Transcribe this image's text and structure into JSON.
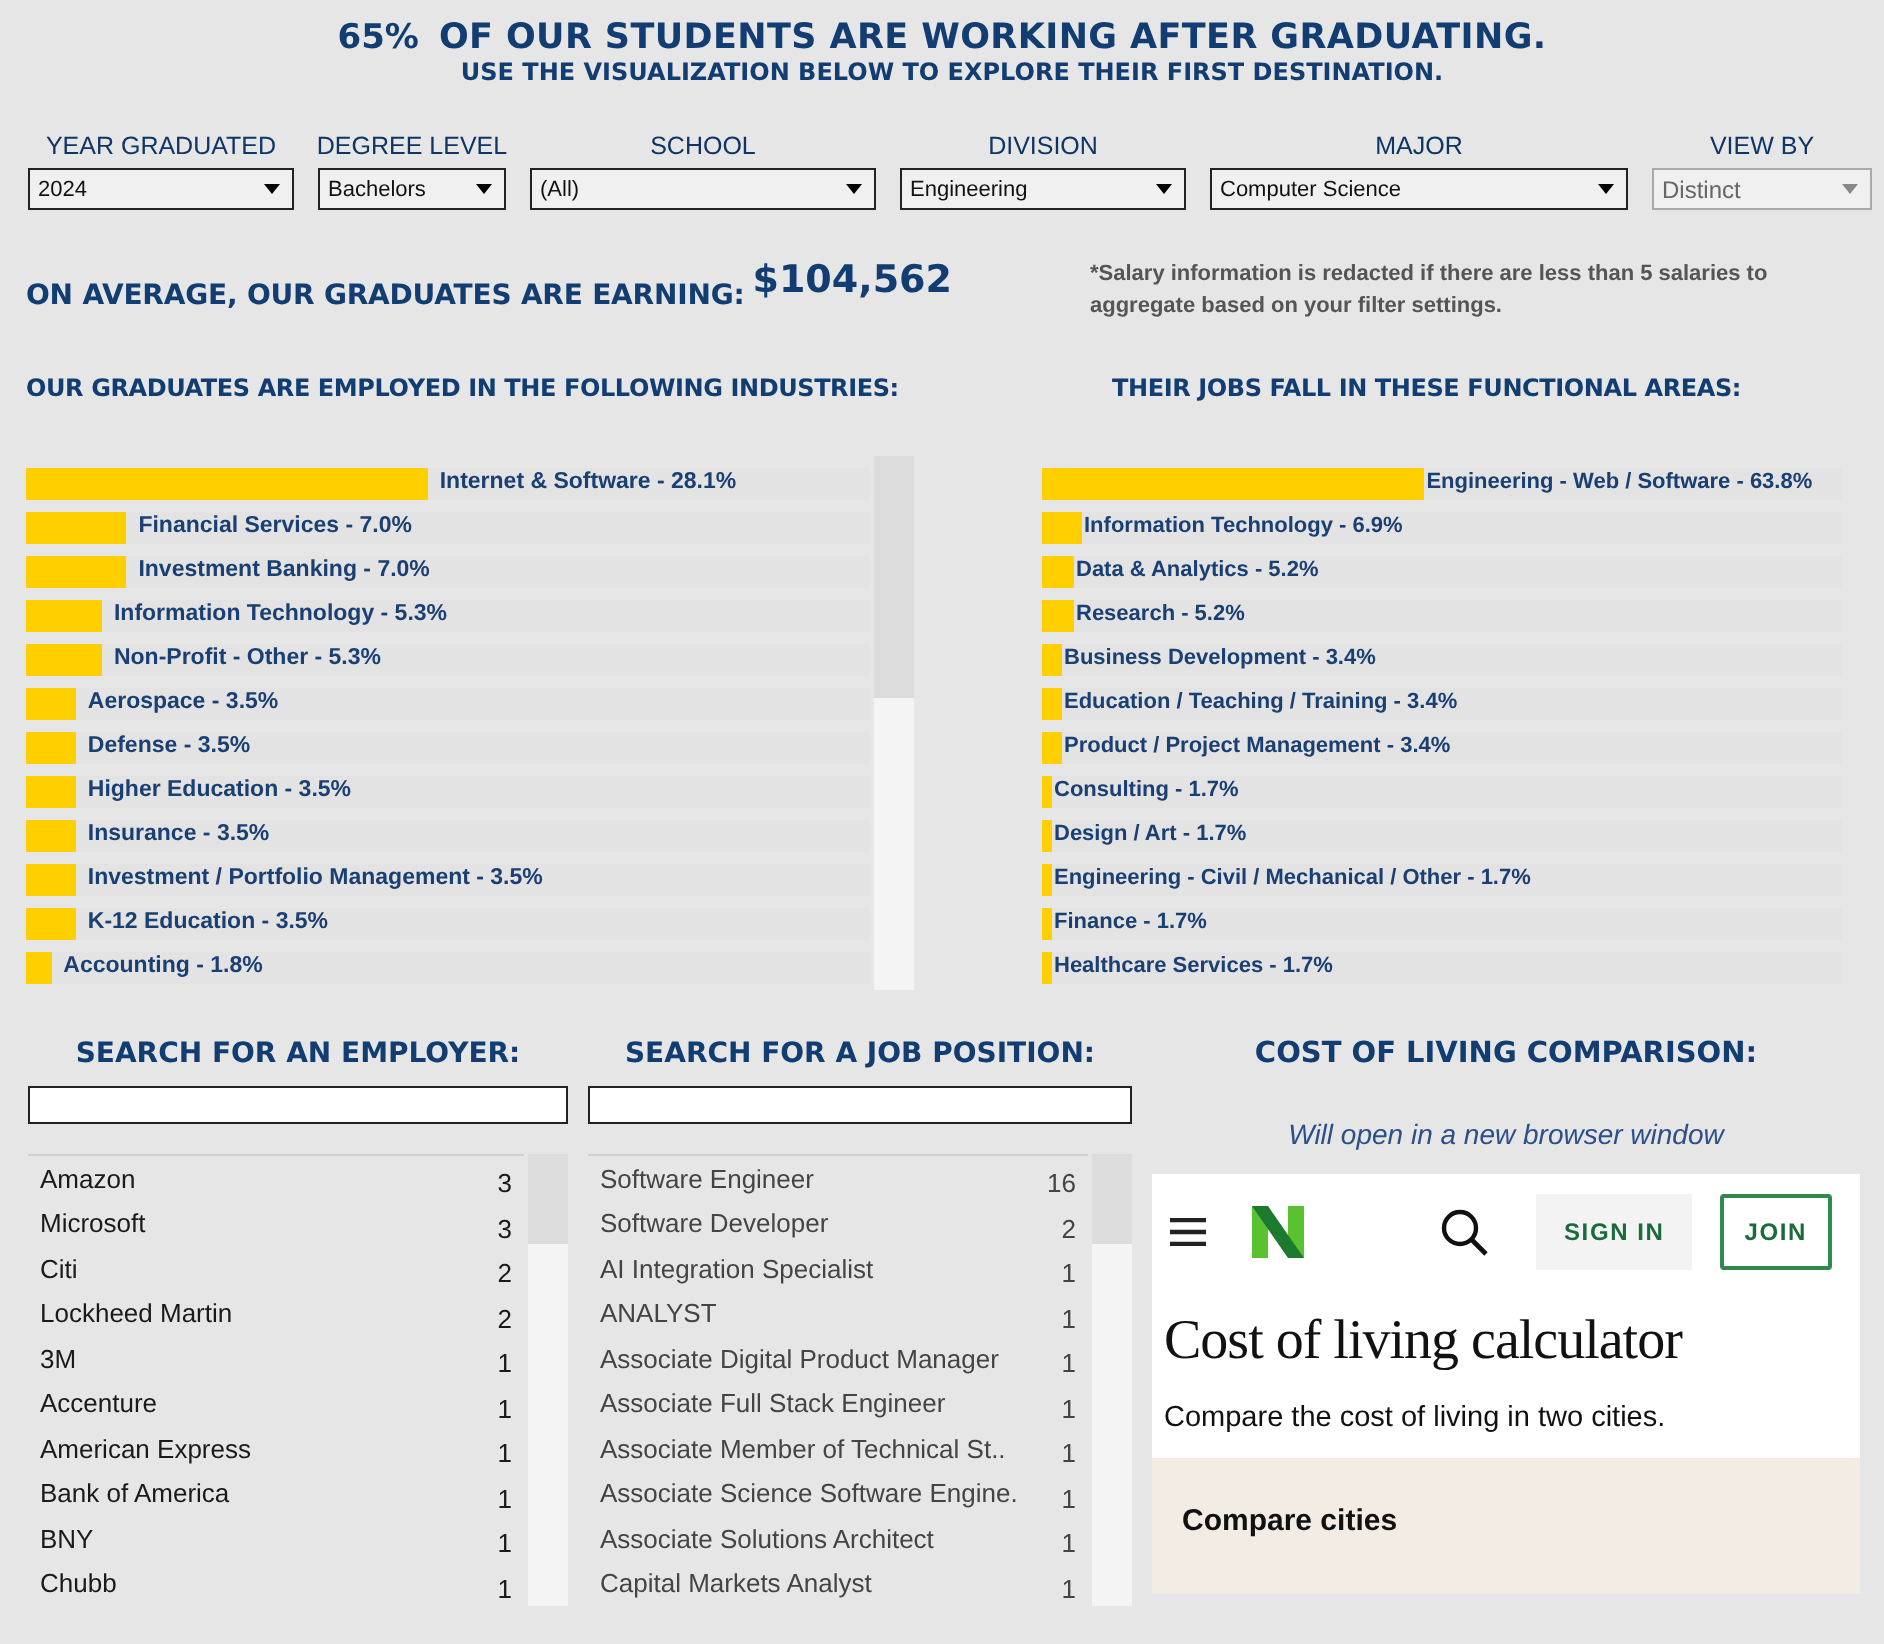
{
  "headline": {
    "percent": "65%",
    "text": "OF OUR STUDENTS ARE WORKING AFTER GRADUATING.",
    "subtitle": "USE THE VISUALIZATION BELOW TO EXPLORE THEIR FIRST DESTINATION."
  },
  "filters": [
    {
      "label": "YEAR GRADUATED",
      "value": "2024",
      "disabled": false
    },
    {
      "label": "DEGREE LEVEL",
      "value": "Bachelors",
      "disabled": false
    },
    {
      "label": "SCHOOL",
      "value": "(All)",
      "disabled": false
    },
    {
      "label": "DIVISION",
      "value": "Engineering",
      "disabled": false
    },
    {
      "label": "MAJOR",
      "value": "Computer Science",
      "disabled": false
    },
    {
      "label": "VIEW BY",
      "value": "Distinct",
      "disabled": true
    }
  ],
  "salary": {
    "label": "ON AVERAGE, OUR GRADUATES ARE EARNING:",
    "amount": "$104,562",
    "note": "*Salary information is redacted if there are less than 5 salaries to aggregate based on your filter settings."
  },
  "industries": {
    "title": "OUR GRADUATES ARE EMPLOYED IN THE FOLLOWING INDUSTRIES:",
    "items": [
      {
        "label": "Internet & Software - 28.1%",
        "level": 0.476
      },
      {
        "label": "Financial Services - 7.0%",
        "level": 0.119
      },
      {
        "label": "Investment Banking - 7.0%",
        "level": 0.119
      },
      {
        "label": "Information Technology - 5.3%",
        "level": 0.09
      },
      {
        "label": "Non-Profit - Other - 5.3%",
        "level": 0.09
      },
      {
        "label": "Aerospace - 3.5%",
        "level": 0.059
      },
      {
        "label": "Defense - 3.5%",
        "level": 0.059
      },
      {
        "label": "Higher Education - 3.5%",
        "level": 0.059
      },
      {
        "label": "Insurance - 3.5%",
        "level": 0.059
      },
      {
        "label": "Investment / Portfolio Management - 3.5%",
        "level": 0.059
      },
      {
        "label": "K-12 Education - 3.5%",
        "level": 0.059
      },
      {
        "label": "Accounting - 1.8%",
        "level": 0.03
      }
    ]
  },
  "functional_areas": {
    "title": "THEIR JOBS FALL IN THESE FUNCTIONAL AREAS:",
    "items": [
      {
        "label": "Engineering - Web / Software - 63.8%",
        "level": 0.478
      },
      {
        "label": "Information Technology - 6.9%",
        "level": 0.05
      },
      {
        "label": "Data & Analytics - 5.2%",
        "level": 0.04
      },
      {
        "label": "Research - 5.2%",
        "level": 0.04
      },
      {
        "label": "Business Development - 3.4%",
        "level": 0.025
      },
      {
        "label": "Education / Teaching / Training - 3.4%",
        "level": 0.025
      },
      {
        "label": "Product / Project Management - 3.4%",
        "level": 0.025
      },
      {
        "label": "Consulting - 1.7%",
        "level": 0.0125
      },
      {
        "label": "Design / Art - 1.7%",
        "level": 0.0125
      },
      {
        "label": "Engineering - Civil / Mechanical / Other - 1.7%",
        "level": 0.0125
      },
      {
        "label": "Finance - 1.7%",
        "level": 0.0125
      },
      {
        "label": "Healthcare Services - 1.7%",
        "level": 0.0125
      }
    ]
  },
  "employer_search": {
    "title": "SEARCH FOR AN EMPLOYER:",
    "items": [
      {
        "name": "Amazon",
        "count": "3"
      },
      {
        "name": "Microsoft",
        "count": "3"
      },
      {
        "name": "Citi",
        "count": "2"
      },
      {
        "name": "Lockheed Martin",
        "count": "2"
      },
      {
        "name": "3M",
        "count": "1"
      },
      {
        "name": "Accenture",
        "count": "1"
      },
      {
        "name": "American Express",
        "count": "1"
      },
      {
        "name": "Bank of America",
        "count": "1"
      },
      {
        "name": "BNY",
        "count": "1"
      },
      {
        "name": "Chubb",
        "count": "1"
      }
    ]
  },
  "job_search": {
    "title": "SEARCH FOR A JOB POSITION:",
    "items": [
      {
        "name": "Software Engineer",
        "count": "16"
      },
      {
        "name": "Software Developer",
        "count": "2"
      },
      {
        "name": "AI Integration Specialist",
        "count": "1"
      },
      {
        "name": "ANALYST",
        "count": "1"
      },
      {
        "name": "Associate Digital Product Manager",
        "count": "1"
      },
      {
        "name": "Associate Full Stack Engineer",
        "count": "1"
      },
      {
        "name": "Associate Member of Technical St..",
        "count": "1"
      },
      {
        "name": "Associate Science Software Engine.",
        "count": "1"
      },
      {
        "name": "Associate Solutions Architect",
        "count": "1"
      },
      {
        "name": "Capital Markets Analyst",
        "count": "1"
      }
    ]
  },
  "cost_of_living": {
    "title": "COST OF LIVING COMPARISON:",
    "note": "Will open in a new browser window",
    "preview": {
      "sign_in": "SIGN IN",
      "join": "JOIN",
      "heading": "Cost of living calculator",
      "subheading": "Compare the cost of living in two cities.",
      "section": "Compare cities"
    }
  }
}
